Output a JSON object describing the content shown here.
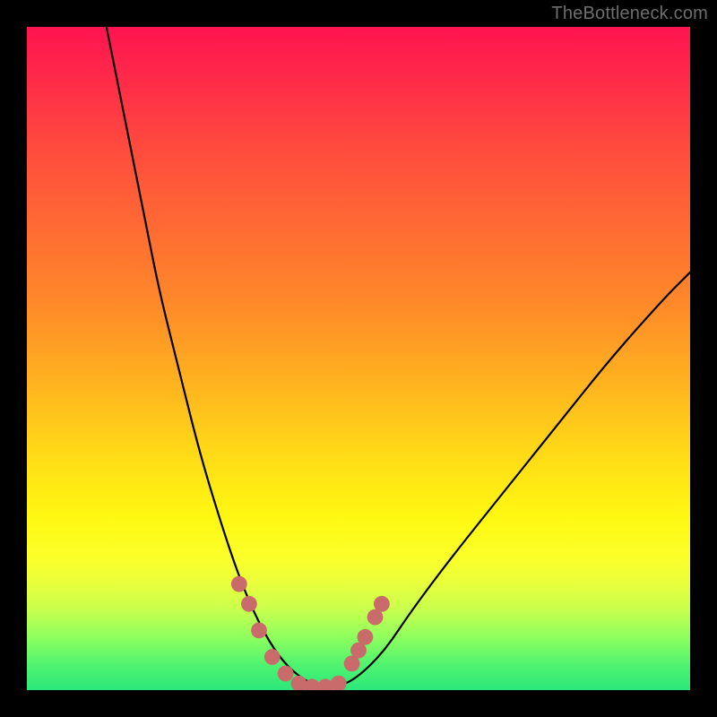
{
  "watermark": "TheBottleneck.com",
  "colors": {
    "frame": "#000000",
    "curve": "#000000",
    "marker": "#c96b6a",
    "gradient_stops": [
      "#ff1450",
      "#ff2b49",
      "#ff4a3e",
      "#ff6a33",
      "#ff8a29",
      "#ffb41f",
      "#ffe016",
      "#fff812",
      "#fbff2a",
      "#e8ff3c",
      "#c7ff4e",
      "#8fff5e",
      "#52f46e",
      "#2be87a"
    ]
  },
  "chart_data": {
    "type": "line",
    "title": "",
    "xlabel": "",
    "ylabel": "",
    "xlim": [
      0,
      100
    ],
    "ylim": [
      0,
      100
    ],
    "note": "Axes have no visible tick labels or titles; values normalized 0–100 over the plot area. y=0 is the bottom (green) edge.",
    "series": [
      {
        "name": "bottleneck-curve",
        "points": [
          {
            "x": 12,
            "y": 100
          },
          {
            "x": 14,
            "y": 90
          },
          {
            "x": 16,
            "y": 80
          },
          {
            "x": 18,
            "y": 70
          },
          {
            "x": 20,
            "y": 60
          },
          {
            "x": 23,
            "y": 48
          },
          {
            "x": 26,
            "y": 36
          },
          {
            "x": 29,
            "y": 26
          },
          {
            "x": 32,
            "y": 17
          },
          {
            "x": 35,
            "y": 10
          },
          {
            "x": 38,
            "y": 5
          },
          {
            "x": 41,
            "y": 2
          },
          {
            "x": 44,
            "y": 0.5
          },
          {
            "x": 47,
            "y": 0.5
          },
          {
            "x": 50,
            "y": 2
          },
          {
            "x": 54,
            "y": 6
          },
          {
            "x": 58,
            "y": 12
          },
          {
            "x": 64,
            "y": 20
          },
          {
            "x": 72,
            "y": 30
          },
          {
            "x": 80,
            "y": 40
          },
          {
            "x": 88,
            "y": 50
          },
          {
            "x": 96,
            "y": 59
          },
          {
            "x": 100,
            "y": 63
          }
        ]
      }
    ],
    "markers": {
      "name": "highlighted-points",
      "color": "#c96b6a",
      "radius_estimate_pct": 1.2,
      "points": [
        {
          "x": 32,
          "y": 16
        },
        {
          "x": 33.5,
          "y": 13
        },
        {
          "x": 35,
          "y": 9
        },
        {
          "x": 37,
          "y": 5
        },
        {
          "x": 39,
          "y": 2.5
        },
        {
          "x": 41,
          "y": 1
        },
        {
          "x": 43,
          "y": 0.5
        },
        {
          "x": 45,
          "y": 0.5
        },
        {
          "x": 47,
          "y": 1
        },
        {
          "x": 49,
          "y": 4
        },
        {
          "x": 50,
          "y": 6
        },
        {
          "x": 51,
          "y": 8
        },
        {
          "x": 52.5,
          "y": 11
        },
        {
          "x": 53.5,
          "y": 13
        }
      ]
    }
  }
}
